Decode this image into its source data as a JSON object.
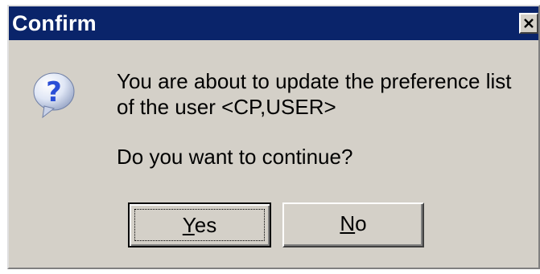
{
  "dialog": {
    "title": "Confirm",
    "close_icon": "close-x-icon",
    "message_icon": "question-mark-icon",
    "message_line1": "You are about to update the preference list",
    "message_line2": "of the user <CP,USER>",
    "question": "Do you want to continue?"
  },
  "buttons": {
    "yes": {
      "accel": "Y",
      "rest": "es"
    },
    "no": {
      "accel": "N",
      "rest": "o"
    }
  },
  "colors": {
    "titlebar": "#0a246a",
    "face": "#d4d0c8",
    "icon_blue": "#2b4fd6"
  }
}
